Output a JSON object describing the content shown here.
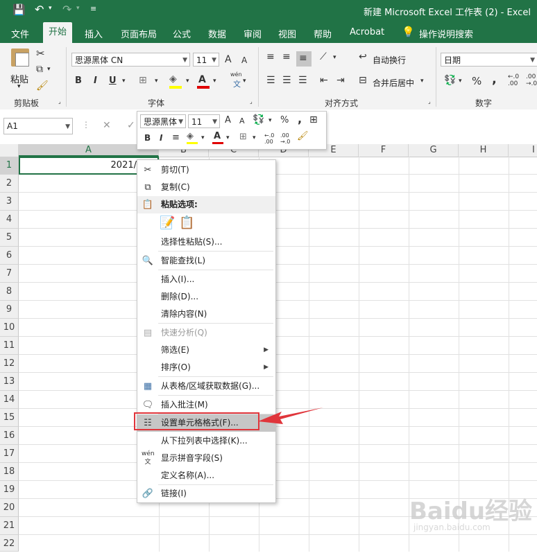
{
  "titlebar": {
    "title": "新建 Microsoft Excel 工作表 (2)  -  Excel",
    "save_icon": "save-icon",
    "undo_icon": "undo-icon",
    "redo_icon": "redo-icon"
  },
  "tabs": [
    "文件",
    "开始",
    "插入",
    "页面布局",
    "公式",
    "数据",
    "审阅",
    "视图",
    "帮助",
    "Acrobat"
  ],
  "active_tab": "开始",
  "tell_me": "操作说明搜索",
  "ribbon": {
    "paste_label": "粘贴",
    "clipboard_label": "剪贴板",
    "font_name": "思源黑体 CN",
    "font_size": "11",
    "font_label": "字体",
    "bold": "B",
    "italic": "I",
    "underline": "U",
    "grow": "A",
    "shrink": "A",
    "wen": "wén",
    "wen_sub": "文",
    "wrap_label": "自动换行",
    "merge_label": "合并后居中",
    "align_label": "对齐方式",
    "number_format": "日期",
    "percent": "%",
    "comma": ",",
    "number_label": "数字",
    "dec_inc": "←.0\n.00",
    "dec_dec": ".00\n→.0"
  },
  "formula_bar": {
    "name_box": "A1",
    "cancel": "✕",
    "enter": "✓"
  },
  "columns": [
    "A",
    "B",
    "C",
    "D",
    "E",
    "F",
    "G",
    "H",
    "I"
  ],
  "rows": [
    "1",
    "2",
    "3",
    "4",
    "5",
    "6",
    "7",
    "8",
    "9",
    "10",
    "11",
    "12",
    "13",
    "14",
    "15",
    "16",
    "17",
    "18",
    "19",
    "20",
    "21",
    "22"
  ],
  "cell_a1": "2021/",
  "mini_toolbar": {
    "font_name": "思源黑体",
    "font_size": "11",
    "grow": "A",
    "shrink": "A",
    "percent": "%",
    "comma": ",",
    "bold": "B",
    "italic": "I"
  },
  "context_menu": {
    "items": [
      {
        "label": "剪切(T)",
        "icon": "scissors-icon"
      },
      {
        "label": "复制(C)",
        "icon": "copy-icon"
      },
      {
        "label": "粘贴选项:",
        "icon": "paste-icon"
      },
      {
        "label": "选择性粘贴(S)...",
        "icon": ""
      },
      {
        "label": "智能查找(L)",
        "icon": "smart-lookup-icon"
      },
      {
        "label": "插入(I)...",
        "icon": ""
      },
      {
        "label": "删除(D)...",
        "icon": ""
      },
      {
        "label": "清除内容(N)",
        "icon": ""
      },
      {
        "label": "快速分析(Q)",
        "icon": "quick-analysis-icon"
      },
      {
        "label": "筛选(E)",
        "icon": ""
      },
      {
        "label": "排序(O)",
        "icon": ""
      },
      {
        "label": "从表格/区域获取数据(G)...",
        "icon": "table-icon"
      },
      {
        "label": "插入批注(M)",
        "icon": "comment-icon"
      },
      {
        "label": "设置单元格格式(F)...",
        "icon": "format-cells-icon"
      },
      {
        "label": "从下拉列表中选择(K)...",
        "icon": ""
      },
      {
        "label": "显示拼音字段(S)",
        "icon": "phonetic-icon"
      },
      {
        "label": "定义名称(A)...",
        "icon": ""
      },
      {
        "label": "链接(I)",
        "icon": "link-icon"
      }
    ]
  },
  "watermark": {
    "brand": "Baidu经验",
    "url": "jingyan.baidu.com"
  },
  "colors": {
    "excel_green": "#217346",
    "highlight_red": "#e0353b",
    "menu_hover": "#c6c6c6"
  }
}
